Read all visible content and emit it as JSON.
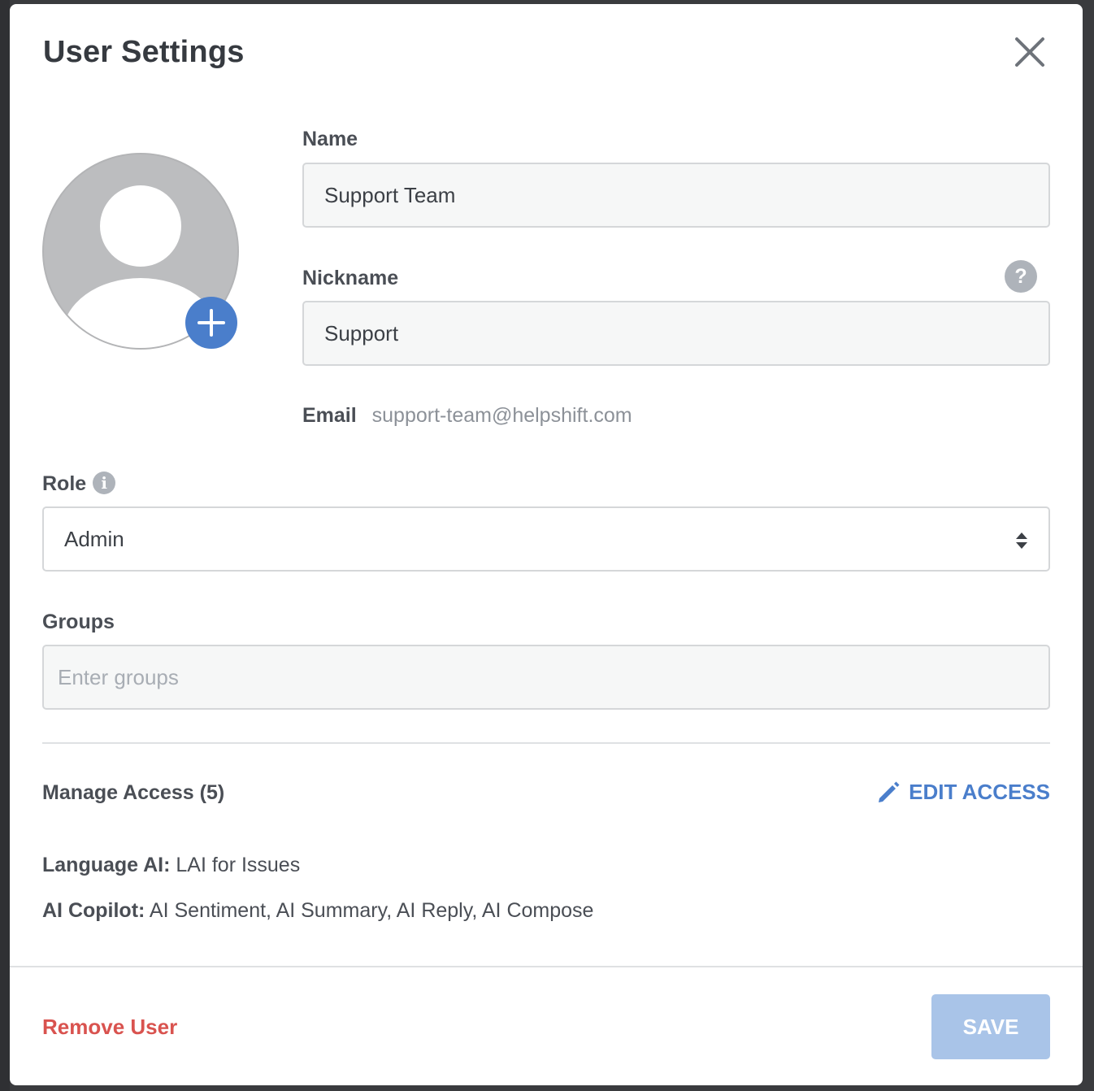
{
  "dialog": {
    "title": "User Settings",
    "close_icon": "close-icon"
  },
  "avatar": {
    "icon": "user-placeholder-icon",
    "add_icon": "plus-icon"
  },
  "form": {
    "name_label": "Name",
    "name_value": "Support Team",
    "nickname_label": "Nickname",
    "nickname_value": "Support",
    "nickname_help": "?",
    "email_label": "Email",
    "email_value": "support-team@helpshift.com",
    "role_label": "Role",
    "role_info": "i",
    "role_value": "Admin",
    "groups_label": "Groups",
    "groups_placeholder": "Enter groups"
  },
  "access": {
    "title": "Manage Access (5)",
    "edit_label": "EDIT ACCESS",
    "edit_icon": "pencil-icon",
    "lines": [
      {
        "key": "Language AI:",
        "value": " LAI for Issues"
      },
      {
        "key": "AI Copilot:",
        "value": " AI Sentiment, AI Summary, AI Reply, AI Compose"
      }
    ]
  },
  "footer": {
    "remove_label": "Remove User",
    "save_label": "SAVE"
  },
  "colors": {
    "accent": "#4a7ecb",
    "danger": "#d9534f",
    "save_disabled": "#a9c4e8"
  }
}
